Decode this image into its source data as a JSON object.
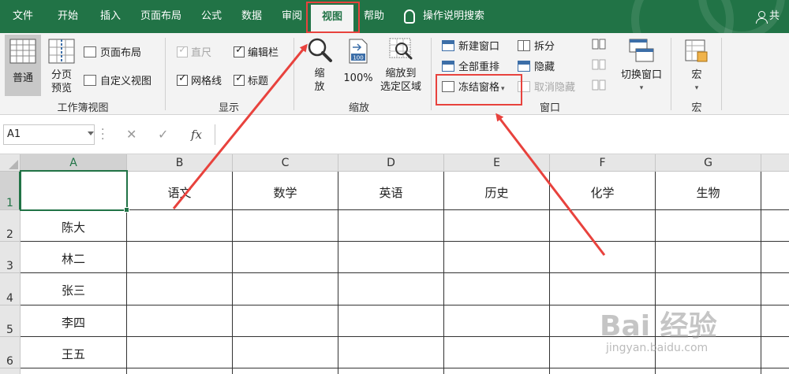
{
  "menu": {
    "tabs": [
      "文件",
      "开始",
      "插入",
      "页面布局",
      "公式",
      "数据",
      "审阅",
      "视图",
      "帮助"
    ],
    "active_tab": "视图",
    "search_label": "操作说明搜索",
    "share_label": "共享"
  },
  "ribbon": {
    "workbook_views": {
      "label": "工作簿视图",
      "normal": "普通",
      "page_break_line1": "分页",
      "page_break_line2": "预览",
      "page_layout": "页面布局",
      "custom_views": "自定义视图"
    },
    "show": {
      "label": "显示",
      "ruler": "直尺",
      "formula_bar": "编辑栏",
      "gridlines": "网格线",
      "headings": "标题"
    },
    "zoom": {
      "label": "缩放",
      "zoom_line1": "缩",
      "zoom_line2": "放",
      "hundred": "100%",
      "zoom_sel_line1": "缩放到",
      "zoom_sel_line2": "选定区域",
      "hundred_badge": "100"
    },
    "window": {
      "label": "窗口",
      "new_window": "新建窗口",
      "arrange_all": "全部重排",
      "freeze_panes": "冻结窗格",
      "split": "拆分",
      "hide": "隐藏",
      "unhide": "取消隐藏",
      "switch_windows": "切换窗口"
    },
    "macros": {
      "label": "宏",
      "macros_btn": "宏"
    }
  },
  "formula_bar": {
    "name_box": "A1",
    "fx": "fx",
    "value": ""
  },
  "sheet": {
    "columns": [
      "A",
      "B",
      "C",
      "D",
      "E",
      "F",
      "G"
    ],
    "rows": [
      "1",
      "2",
      "3",
      "4",
      "5",
      "6"
    ],
    "header_row": [
      "",
      "语文",
      "数学",
      "英语",
      "历史",
      "化学",
      "生物"
    ],
    "names": [
      "陈大",
      "林二",
      "张三",
      "李四",
      "王五"
    ]
  },
  "watermark": {
    "text": "Bai 经验",
    "url": "jingyan.baidu.com"
  }
}
